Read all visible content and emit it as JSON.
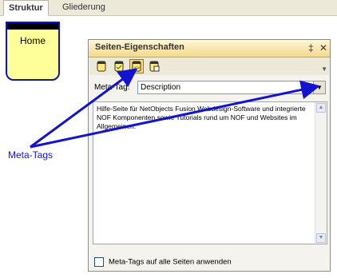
{
  "tabs": [
    {
      "label": "Struktur"
    },
    {
      "label": "Gliederung"
    }
  ],
  "home_node": {
    "label": "Home"
  },
  "dialog": {
    "title": "Seiten-Eigenschaften",
    "pin_symbol": "‡",
    "close_symbol": "✕",
    "meta_label": "Meta-Tag:",
    "meta_selected": "Description",
    "text": "Hilfe-Seite für NetObjects Fusion Webdesign-Software und integrierte NOF Komponenten sowie Tutorials rund um NOF und Websites im Allgemeinen.",
    "checkbox_label": "Meta-Tags auf alle Seiten anwenden"
  },
  "annotation": "Meta-Tags",
  "colors": {
    "arrow": "#1414d0",
    "node_border": "#1010c8",
    "node_fill": "#ffff99"
  }
}
